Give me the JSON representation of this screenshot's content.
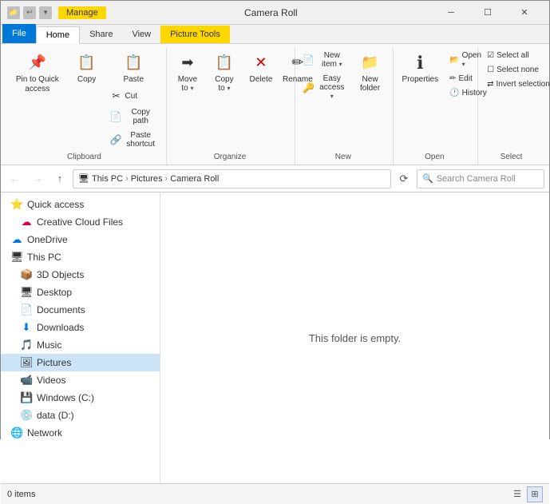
{
  "titlebar": {
    "manage_label": "Manage",
    "title": "Camera Roll",
    "min_label": "─",
    "max_label": "☐",
    "close_label": "✕",
    "quick_access_icon": "📌",
    "undo_icon": "↩",
    "redo_icon": "↪",
    "down_icon": "▾"
  },
  "tabs": {
    "file": "File",
    "home": "Home",
    "share": "Share",
    "view": "View",
    "picture_tools": "Picture Tools"
  },
  "ribbon": {
    "clipboard": {
      "label": "Clipboard",
      "pin_label": "Pin to Quick\naccess",
      "copy_label": "Copy",
      "paste_label": "Paste",
      "cut_label": "Cut",
      "copy_path_label": "Copy path",
      "paste_shortcut_label": "Paste shortcut"
    },
    "organize": {
      "label": "Organize",
      "move_to_label": "Move\nto ",
      "copy_to_label": "Copy\nto ",
      "delete_label": "Delete",
      "rename_label": "Rename"
    },
    "new": {
      "label": "New",
      "new_folder_label": "New\nfolder",
      "new_item_label": "New item ",
      "easy_access_label": "Easy access "
    },
    "open": {
      "label": "Open",
      "properties_label": "Properties",
      "open_label": "Open ",
      "edit_label": "Edit",
      "history_label": "History"
    },
    "select": {
      "label": "Select",
      "select_all_label": "Select all",
      "select_none_label": "Select none",
      "invert_label": "Invert selection"
    }
  },
  "addressbar": {
    "breadcrumb": [
      "This PC",
      "Pictures",
      "Camera Roll"
    ],
    "search_placeholder": "Search Camera Roll",
    "refresh_icon": "⟳"
  },
  "sidebar": {
    "items": [
      {
        "label": "Quick access",
        "icon": "⭐",
        "indent": 0
      },
      {
        "label": "Creative Cloud Files",
        "icon": "☁",
        "indent": 0,
        "color": "#d04"
      },
      {
        "label": "OneDrive",
        "icon": "☁",
        "indent": 0,
        "color": "#0078d7"
      },
      {
        "label": "This PC",
        "icon": "🖥",
        "indent": 0
      },
      {
        "label": "3D Objects",
        "icon": "📦",
        "indent": 1
      },
      {
        "label": "Desktop",
        "icon": "🖥",
        "indent": 1
      },
      {
        "label": "Documents",
        "icon": "📄",
        "indent": 1
      },
      {
        "label": "Downloads",
        "icon": "⬇",
        "indent": 1
      },
      {
        "label": "Music",
        "icon": "🎵",
        "indent": 1
      },
      {
        "label": "Pictures",
        "icon": "🖼",
        "indent": 1,
        "selected": true
      },
      {
        "label": "Videos",
        "icon": "📹",
        "indent": 1
      },
      {
        "label": "Windows (C:)",
        "icon": "💾",
        "indent": 1
      },
      {
        "label": "data (D:)",
        "icon": "💿",
        "indent": 1
      },
      {
        "label": "Network",
        "icon": "🌐",
        "indent": 0
      }
    ]
  },
  "content": {
    "empty_message": "This folder is empty."
  },
  "statusbar": {
    "items_count": "0 items"
  }
}
